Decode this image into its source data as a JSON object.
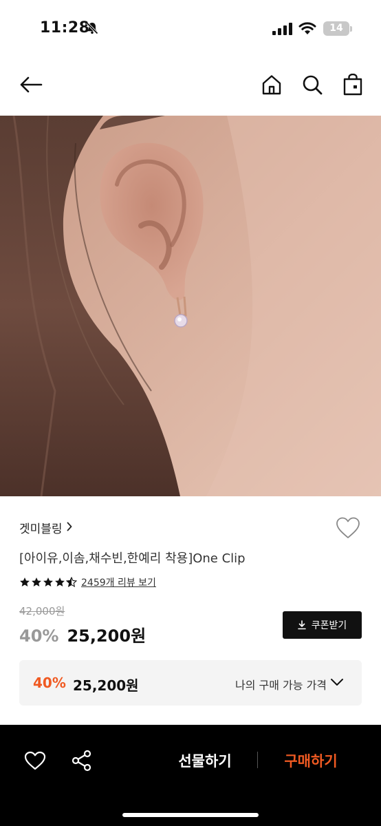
{
  "status_bar": {
    "time": "11:28",
    "battery": "14",
    "icons": [
      "bell-slash-icon",
      "cellular-signal-icon",
      "wifi-icon",
      "battery-icon"
    ]
  },
  "nav": {
    "icons": [
      "back-arrow-icon",
      "home-icon",
      "search-icon",
      "shopping-bag-icon"
    ]
  },
  "product": {
    "image_alt": "ear-with-gold-hoop-crystal-earring",
    "brand": "겟미블링",
    "title": "[아이유,이솜,채수빈,한예리 착용]One Clip",
    "rating": 4.5,
    "review_link": "2459개 리뷰 보기",
    "original_price": "42,000원",
    "sale_rate": "40%",
    "sale_price": "25,200원",
    "coupon_button": "쿠폰받기"
  },
  "my_price": {
    "rate": "40%",
    "price": "25,200원",
    "label": "나의 구매 가능 가격"
  },
  "bottom_bar": {
    "gift_label": "선물하기",
    "buy_label": "구매하기"
  },
  "colors": {
    "accent": "#f05a22",
    "black": "#111111",
    "muted": "#999999",
    "panel": "#f4f4f4"
  }
}
